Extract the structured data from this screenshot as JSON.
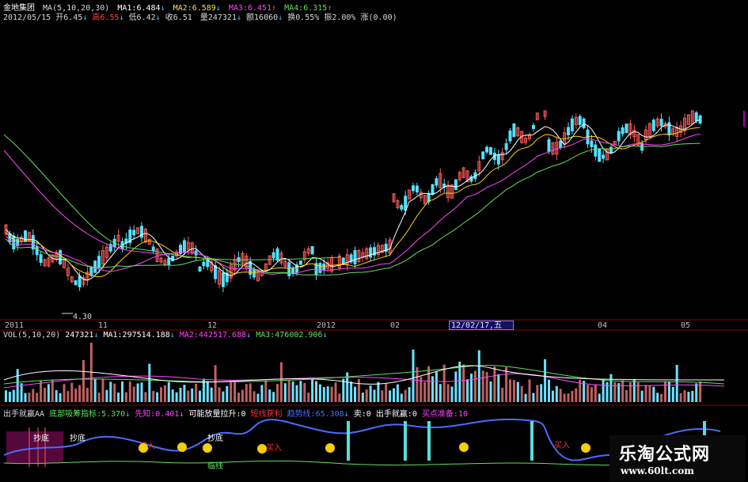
{
  "header": {
    "stock_name": "金地集团",
    "ma_label": "MA(5,10,20,30)",
    "ma1": "MA1:6.484",
    "ma2": "MA2:6.589",
    "ma3": "MA3:6.451",
    "ma4": "MA4:6.315",
    "date": "2012/05/15",
    "open": "开6.45",
    "high": "高6.55",
    "low": "低6.42",
    "close": "收6.51",
    "volume": "量247321",
    "amount": "额16060",
    "turnover": "换0.55%",
    "amplitude": "振2.00%",
    "change": "涨(0.00)"
  },
  "price_panel": {
    "low_note": "4.30"
  },
  "date_axis": {
    "labels": [
      "2011",
      "11",
      "12",
      "2012",
      "02",
      "04",
      "05"
    ],
    "highlight": "12/02/17,五"
  },
  "volume_panel": {
    "label": "VOL(5,10,20)",
    "vol": "247321",
    "ma1": "MA1:297514.188",
    "ma2": "MA2:442517.688",
    "ma3": "MA3:476002.906"
  },
  "indicator_panel": {
    "name": "出手就赢AA",
    "absorb": "底部吸筹指标:5.370",
    "foreknow": "先知:0.401",
    "vol_rise": "可能放量拉升:0",
    "profit": "短线获利",
    "trend": "趋势线:65.308",
    "sell": "卖:0",
    "win": "出手就赢:0",
    "buy_prep": "买点准备:10",
    "chaodi": "抄底",
    "mairu": "买入",
    "jiansuo": "临线"
  },
  "watermark": {
    "title": "乐淘公式网",
    "url": "www.60lt.com"
  },
  "colors": {
    "up": "#ff4040",
    "down": "#40c0ff",
    "ma1": "#ffffff",
    "ma2": "#ffd000",
    "ma3": "#ff44ff",
    "ma4": "#60e060",
    "trend": "#4a6cff"
  },
  "chart_data": {
    "type": "candlestick",
    "title": "金地集团",
    "x_labels": [
      "2011",
      "11",
      "12",
      "2012",
      "02",
      "04",
      "05"
    ],
    "series": [
      {
        "name": "MA1",
        "values": [
          6.48
        ]
      },
      {
        "name": "MA2",
        "values": [
          6.59
        ]
      },
      {
        "name": "MA3",
        "values": [
          6.45
        ]
      },
      {
        "name": "MA4",
        "values": [
          6.32
        ]
      }
    ]
  }
}
